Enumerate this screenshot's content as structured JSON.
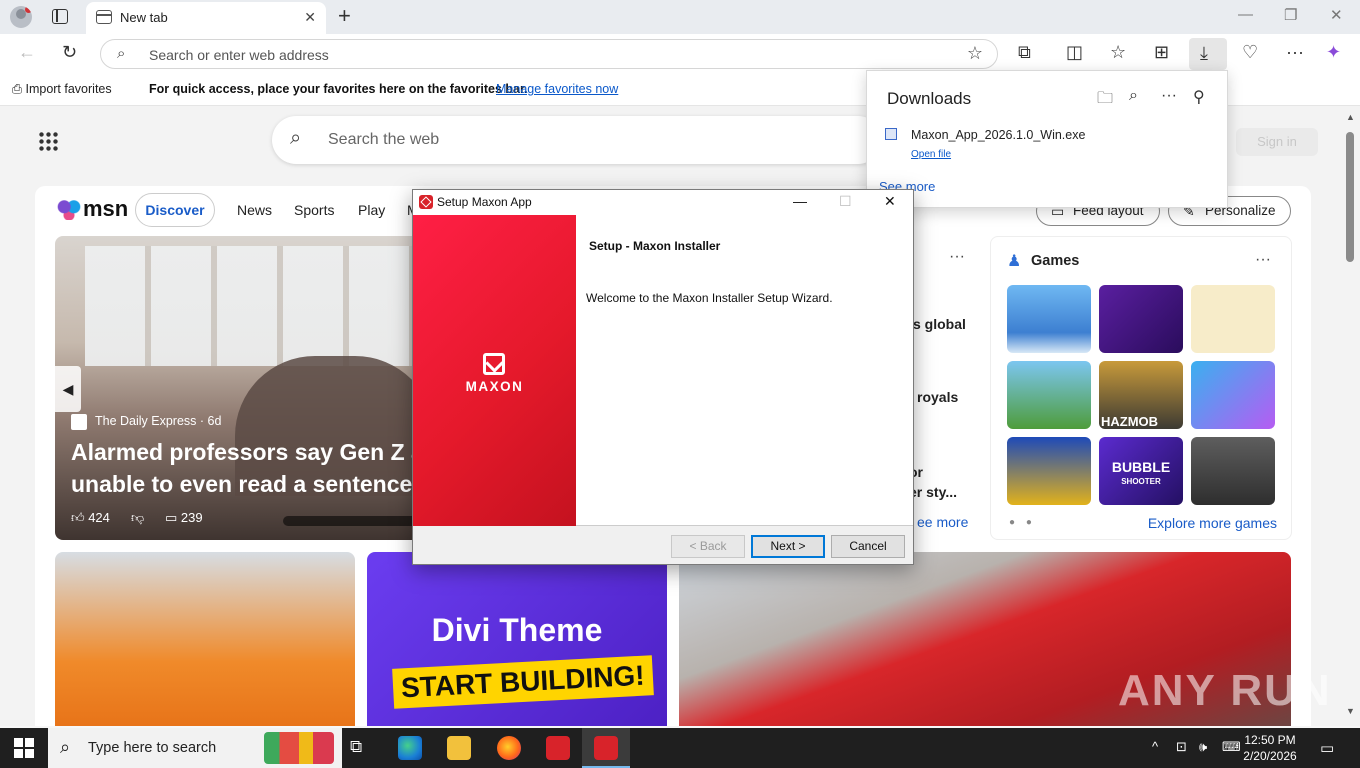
{
  "browser": {
    "tab_title": "New tab",
    "address_placeholder": "Search or enter web address",
    "favbar": {
      "import_label": "Import favorites",
      "message": "For quick access, place your favorites here on the favorites bar.",
      "manage_link": "Manage favorites now"
    }
  },
  "newtab": {
    "search_placeholder": "Search the web",
    "signin_label": "Sign in"
  },
  "msn": {
    "logo": "msn",
    "nav": [
      "Discover",
      "News",
      "Sports",
      "Play",
      "M"
    ],
    "feed_layout": "Feed layout",
    "personalize": "Personalize",
    "hero": {
      "source": "The Daily Express · 6d",
      "headline_line1": "Alarmed professors say Gen Z a",
      "headline_line2": "unable to even read a sentence",
      "likes": "424",
      "comments": "239"
    },
    "trending": {
      "more": "···",
      "t1": "s global",
      "t2": "royals",
      "t3": "or",
      "t4": "er sty...",
      "see_more": "ee more"
    },
    "games": {
      "title": "Games",
      "more": "···",
      "explore": "Explore more games",
      "tiles": [
        "hazmob",
        "bubble-shooter"
      ],
      "hazmob_label": "HAZMOB",
      "bubble_label": "BUBBLE",
      "bubble_sub": "SHOOTER"
    },
    "divi": {
      "title": "Divi Theme",
      "cta": "START BUILDING!"
    },
    "watermark": "ANY RUN"
  },
  "downloads": {
    "title": "Downloads",
    "file_name": "Maxon_App_2026.1.0_Win.exe",
    "open_file": "Open file",
    "see_more": "See more"
  },
  "dialog": {
    "title": "Setup Maxon App",
    "brand": "MAXON",
    "heading": "Setup - Maxon Installer",
    "welcome": "Welcome to the Maxon Installer Setup Wizard.",
    "back_label": "< Back",
    "next_label": "Next >",
    "cancel_label": "Cancel"
  },
  "taskbar": {
    "search_placeholder": "Type here to search",
    "time": "12:50 PM",
    "date": "2/20/2026"
  },
  "colors": {
    "accent_link": "#1a5cc8",
    "maxon_red": "#e5192b",
    "taskbar": "#1f1f1f"
  }
}
